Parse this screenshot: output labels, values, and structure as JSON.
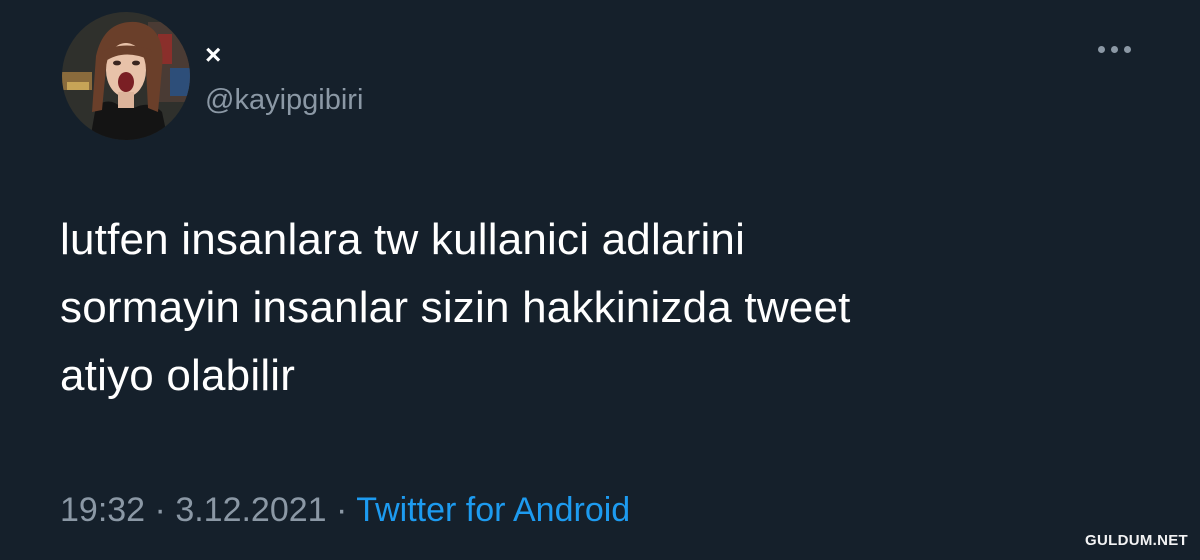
{
  "tweet": {
    "display_name": "×",
    "handle": "@kayipgibiri",
    "text": "lutfen insanlara tw kullanici adlarini\nsormayin insanlar sizin hakkinizda tweet\natiyo olabilir",
    "time": "19:32",
    "separator": " · ",
    "date": "3.12.2021",
    "source": "Twitter for Android",
    "more_icon": "more-horizontal-icon"
  },
  "watermark": "GULDUM.NET",
  "colors": {
    "background": "#15202b",
    "text": "#ffffff",
    "secondary": "#8b98a5",
    "link": "#1d9bf0"
  }
}
